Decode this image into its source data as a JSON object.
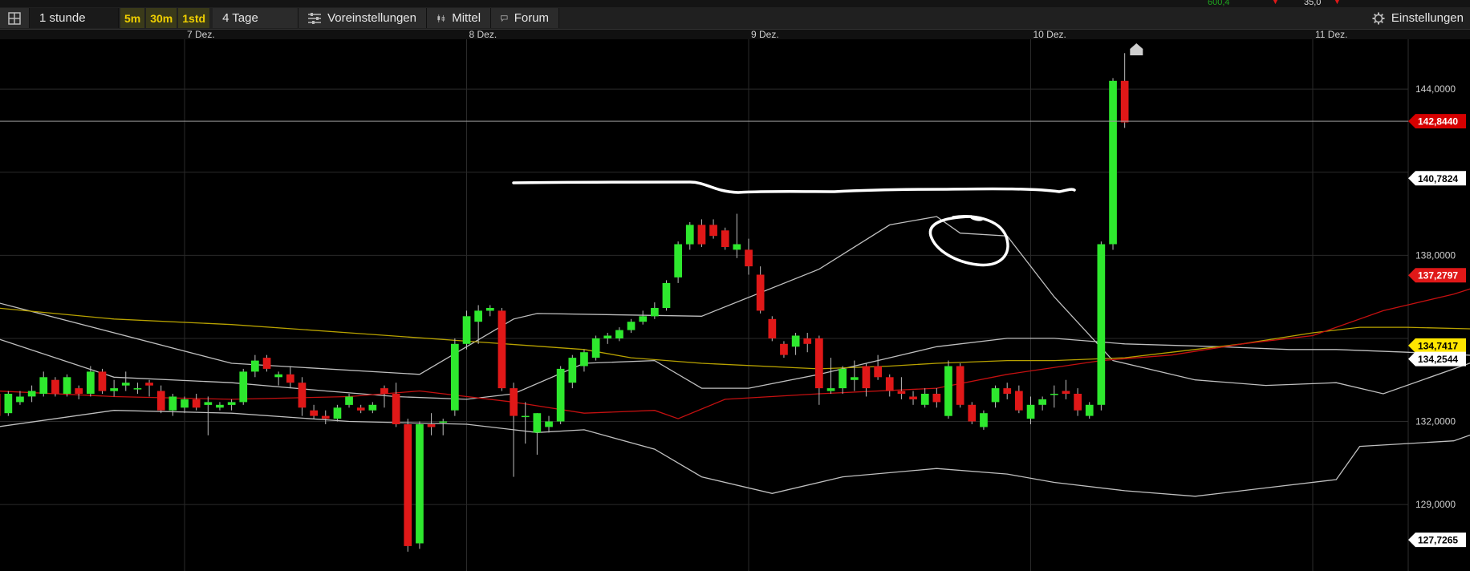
{
  "toolbar": {
    "interval": "1 stunde",
    "timeframes": [
      "5m",
      "30m",
      "1std"
    ],
    "range": "4 Tage",
    "presets": "Voreinstellungen",
    "average": "Mittel",
    "forum": "Forum",
    "settings": "Einstellungen",
    "top_numbers": [
      "600,4",
      "35,0"
    ]
  },
  "chart_data": {
    "type": "candlestick",
    "x_tick_labels": [
      "7 Dez.",
      "8 Dez.",
      "9 Dez.",
      "10 Dez.",
      "11 Dez."
    ],
    "y_tick_labels": [
      "144,0000",
      "138,0000",
      "132,0000",
      "129,0000"
    ],
    "y_ticks": [
      144,
      141,
      138,
      135,
      132,
      129
    ],
    "ylim": [
      126.6,
      145.8
    ],
    "candles_per_day": 24,
    "first_candle_offset": -16,
    "grid": true,
    "candles": [
      [
        133.0,
        133.2,
        132.0,
        132.2
      ],
      [
        132.3,
        133.1,
        132.2,
        133.0
      ],
      [
        132.7,
        133.1,
        132.6,
        132.9
      ],
      [
        132.9,
        133.3,
        132.7,
        133.1
      ],
      [
        133.0,
        133.8,
        132.9,
        133.6
      ],
      [
        133.5,
        133.6,
        132.9,
        133.0
      ],
      [
        133.0,
        133.7,
        132.9,
        133.6
      ],
      [
        133.2,
        133.3,
        132.8,
        133.0
      ],
      [
        133.0,
        134.0,
        132.9,
        133.8
      ],
      [
        133.8,
        133.9,
        133.0,
        133.1
      ],
      [
        133.1,
        133.5,
        132.9,
        133.2
      ],
      [
        133.3,
        133.8,
        133.1,
        133.4
      ],
      [
        133.2,
        133.4,
        133.0,
        133.2
      ],
      [
        133.4,
        133.5,
        132.9,
        133.3
      ],
      [
        133.1,
        133.3,
        132.3,
        132.4
      ],
      [
        132.4,
        133.0,
        132.2,
        132.9
      ],
      [
        132.5,
        132.9,
        132.3,
        132.8
      ],
      [
        132.8,
        133.0,
        132.4,
        132.5
      ],
      [
        132.6,
        132.9,
        131.5,
        132.7
      ],
      [
        132.5,
        132.7,
        132.4,
        132.6
      ],
      [
        132.6,
        132.8,
        132.4,
        132.7
      ],
      [
        132.7,
        133.9,
        132.6,
        133.8
      ],
      [
        133.8,
        134.4,
        133.6,
        134.2
      ],
      [
        134.3,
        134.4,
        133.8,
        133.9
      ],
      [
        133.6,
        133.8,
        133.3,
        133.7
      ],
      [
        133.7,
        134.0,
        133.2,
        133.4
      ],
      [
        133.4,
        133.6,
        132.2,
        132.5
      ],
      [
        132.4,
        132.6,
        132.1,
        132.2
      ],
      [
        132.2,
        132.4,
        131.9,
        132.1
      ],
      [
        132.1,
        132.6,
        132.0,
        132.5
      ],
      [
        132.6,
        133.0,
        132.5,
        132.9
      ],
      [
        132.5,
        132.6,
        132.3,
        132.4
      ],
      [
        132.4,
        132.7,
        132.3,
        132.6
      ],
      [
        133.2,
        133.3,
        132.5,
        133.0
      ],
      [
        133.0,
        133.4,
        131.8,
        131.9
      ],
      [
        131.9,
        132.1,
        127.3,
        127.5
      ],
      [
        127.6,
        132.0,
        127.4,
        131.9
      ],
      [
        131.9,
        132.3,
        131.5,
        131.8
      ],
      [
        132.0,
        132.1,
        131.5,
        132.0
      ],
      [
        132.4,
        135.0,
        132.2,
        134.8
      ],
      [
        134.8,
        136.0,
        134.6,
        135.8
      ],
      [
        135.6,
        136.2,
        134.8,
        136.0
      ],
      [
        136.0,
        136.2,
        135.8,
        136.1
      ],
      [
        136.0,
        136.1,
        133.1,
        133.2
      ],
      [
        133.2,
        133.4,
        130.0,
        132.2
      ],
      [
        132.2,
        132.7,
        131.2,
        132.2
      ],
      [
        131.6,
        132.3,
        130.8,
        132.3
      ],
      [
        131.8,
        132.2,
        131.6,
        132.0
      ],
      [
        132.0,
        134.0,
        131.9,
        133.9
      ],
      [
        133.4,
        134.4,
        133.2,
        134.3
      ],
      [
        134.0,
        134.6,
        133.8,
        134.5
      ],
      [
        134.3,
        135.1,
        134.2,
        135.0
      ],
      [
        135.0,
        135.2,
        134.8,
        135.1
      ],
      [
        135.0,
        135.4,
        134.9,
        135.3
      ],
      [
        135.3,
        135.7,
        135.2,
        135.6
      ],
      [
        135.6,
        136.0,
        135.5,
        135.8
      ],
      [
        135.8,
        136.3,
        135.7,
        136.1
      ],
      [
        136.1,
        137.1,
        136.0,
        137.0
      ],
      [
        137.2,
        138.5,
        137.0,
        138.4
      ],
      [
        138.4,
        139.2,
        138.2,
        139.1
      ],
      [
        139.1,
        139.3,
        138.3,
        138.4
      ],
      [
        139.1,
        139.3,
        138.6,
        138.7
      ],
      [
        138.9,
        139.0,
        138.2,
        138.3
      ],
      [
        138.2,
        139.5,
        137.9,
        138.4
      ],
      [
        138.2,
        138.6,
        137.3,
        137.6
      ],
      [
        137.3,
        137.6,
        135.9,
        136.0
      ],
      [
        135.7,
        135.8,
        134.9,
        135.0
      ],
      [
        134.8,
        134.9,
        134.3,
        134.4
      ],
      [
        134.7,
        135.2,
        134.4,
        135.1
      ],
      [
        135.0,
        135.2,
        134.5,
        134.8
      ],
      [
        135.0,
        135.1,
        132.6,
        133.2
      ],
      [
        133.1,
        134.3,
        133.0,
        133.2
      ],
      [
        133.2,
        134.0,
        133.0,
        133.9
      ],
      [
        133.5,
        134.2,
        133.1,
        133.6
      ],
      [
        134.0,
        134.1,
        132.9,
        133.2
      ],
      [
        134.0,
        134.4,
        133.5,
        133.6
      ],
      [
        133.6,
        133.7,
        132.9,
        133.1
      ],
      [
        133.1,
        133.6,
        132.8,
        133.0
      ],
      [
        132.9,
        133.1,
        132.6,
        132.8
      ],
      [
        132.6,
        133.2,
        132.5,
        133.0
      ],
      [
        133.0,
        133.2,
        132.5,
        132.7
      ],
      [
        132.2,
        134.2,
        132.1,
        134.0
      ],
      [
        134.0,
        134.1,
        132.5,
        132.6
      ],
      [
        132.6,
        132.7,
        131.9,
        132.0
      ],
      [
        131.8,
        132.4,
        131.7,
        132.3
      ],
      [
        132.7,
        133.3,
        132.5,
        133.2
      ],
      [
        133.2,
        133.4,
        132.8,
        133.0
      ],
      [
        133.1,
        133.3,
        132.3,
        132.4
      ],
      [
        132.1,
        132.9,
        131.9,
        132.6
      ],
      [
        132.6,
        132.9,
        132.4,
        132.8
      ],
      [
        133.0,
        133.3,
        132.5,
        133.0
      ],
      [
        133.1,
        133.5,
        132.8,
        133.0
      ],
      [
        133.0,
        133.2,
        132.2,
        132.4
      ],
      [
        132.2,
        132.7,
        132.1,
        132.6
      ],
      [
        132.6,
        138.5,
        132.4,
        138.4
      ],
      [
        138.4,
        144.4,
        138.2,
        144.3
      ],
      [
        144.3,
        145.3,
        142.6,
        142.8
      ]
    ],
    "bollinger_upper": [
      [
        0,
        136.3
      ],
      [
        20,
        134.1
      ],
      [
        36,
        133.7
      ],
      [
        44,
        135.7
      ],
      [
        46,
        135.9
      ],
      [
        60,
        135.8
      ],
      [
        70,
        137.5
      ],
      [
        76,
        139.1
      ],
      [
        80,
        139.4
      ],
      [
        82,
        138.8
      ],
      [
        86,
        138.7
      ],
      [
        90,
        136.5
      ],
      [
        95,
        134.2
      ],
      [
        102,
        133.5
      ],
      [
        108,
        133.3
      ],
      [
        114,
        133.4
      ],
      [
        118,
        133.0
      ],
      [
        126,
        134.2
      ],
      [
        137,
        134.3
      ],
      [
        146,
        137.3
      ],
      [
        154,
        138.9
      ],
      [
        164,
        140.1
      ],
      [
        168,
        138.9
      ],
      [
        169,
        140.4
      ]
    ],
    "bollinger_middle": [
      [
        0,
        135.0
      ],
      [
        10,
        133.6
      ],
      [
        20,
        133.4
      ],
      [
        28,
        133.1
      ],
      [
        34,
        132.9
      ],
      [
        40,
        132.8
      ],
      [
        44,
        133.0
      ],
      [
        50,
        134.1
      ],
      [
        56,
        134.2
      ],
      [
        60,
        133.2
      ],
      [
        64,
        133.2
      ],
      [
        70,
        133.7
      ],
      [
        76,
        134.3
      ],
      [
        80,
        134.7
      ],
      [
        86,
        135.0
      ],
      [
        90,
        135.0
      ],
      [
        96,
        134.8
      ],
      [
        104,
        134.7
      ],
      [
        110,
        134.6
      ],
      [
        114,
        134.6
      ],
      [
        120,
        134.5
      ],
      [
        130,
        134.3
      ],
      [
        134,
        134.3
      ],
      [
        138,
        134.6
      ],
      [
        146,
        135.4
      ],
      [
        150,
        135.5
      ],
      [
        154,
        135.4
      ],
      [
        160,
        134.7
      ],
      [
        164,
        134.3
      ],
      [
        168,
        133.3
      ],
      [
        170,
        133.7
      ],
      [
        172,
        134.4
      ]
    ],
    "bollinger_lower": [
      [
        0,
        131.8
      ],
      [
        10,
        132.4
      ],
      [
        20,
        132.3
      ],
      [
        30,
        132.0
      ],
      [
        40,
        131.9
      ],
      [
        46,
        131.6
      ],
      [
        50,
        131.7
      ],
      [
        56,
        131.0
      ],
      [
        60,
        130.0
      ],
      [
        66,
        129.4
      ],
      [
        72,
        130.0
      ],
      [
        80,
        130.3
      ],
      [
        86,
        130.1
      ],
      [
        90,
        129.8
      ],
      [
        96,
        129.5
      ],
      [
        102,
        129.3
      ],
      [
        108,
        129.6
      ],
      [
        114,
        129.9
      ],
      [
        116,
        131.1
      ],
      [
        124,
        131.3
      ],
      [
        128,
        131.9
      ],
      [
        134,
        132.4
      ],
      [
        138,
        132.6
      ],
      [
        144,
        132.4
      ],
      [
        150,
        131.6
      ],
      [
        156,
        130.8
      ],
      [
        164,
        131.4
      ],
      [
        168,
        131.6
      ],
      [
        170,
        131.4
      ],
      [
        172,
        129.5
      ],
      [
        174,
        128.6
      ],
      [
        176,
        128.0
      ]
    ],
    "sma_yellow": [
      [
        0,
        136.1
      ],
      [
        10,
        135.7
      ],
      [
        20,
        135.5
      ],
      [
        30,
        135.2
      ],
      [
        40,
        134.9
      ],
      [
        50,
        134.6
      ],
      [
        54,
        134.3
      ],
      [
        60,
        134.1
      ],
      [
        70,
        133.9
      ],
      [
        76,
        134.0
      ],
      [
        80,
        134.1
      ],
      [
        86,
        134.2
      ],
      [
        90,
        134.2
      ],
      [
        96,
        134.3
      ],
      [
        100,
        134.5
      ],
      [
        106,
        134.8
      ],
      [
        112,
        135.2
      ],
      [
        116,
        135.4
      ],
      [
        120,
        135.4
      ],
      [
        130,
        135.3
      ],
      [
        134,
        135.3
      ],
      [
        138,
        135.2
      ],
      [
        144,
        134.9
      ],
      [
        150,
        134.6
      ],
      [
        156,
        134.3
      ],
      [
        162,
        134.4
      ],
      [
        166,
        134.5
      ],
      [
        168,
        134.5
      ],
      [
        170,
        134.6
      ],
      [
        174,
        135.0
      ],
      [
        176,
        135.3
      ]
    ],
    "ema_red": [
      [
        0,
        133.1
      ],
      [
        10,
        132.9
      ],
      [
        20,
        132.8
      ],
      [
        30,
        132.9
      ],
      [
        36,
        133.1
      ],
      [
        44,
        132.7
      ],
      [
        50,
        132.3
      ],
      [
        56,
        132.4
      ],
      [
        58,
        132.1
      ],
      [
        62,
        132.8
      ],
      [
        70,
        133.0
      ],
      [
        80,
        133.2
      ],
      [
        86,
        133.7
      ],
      [
        94,
        134.2
      ],
      [
        100,
        134.4
      ],
      [
        106,
        134.8
      ],
      [
        112,
        135.1
      ],
      [
        118,
        136.0
      ],
      [
        124,
        136.6
      ],
      [
        130,
        137.4
      ],
      [
        134,
        137.2
      ],
      [
        138,
        136.8
      ],
      [
        144,
        135.7
      ],
      [
        150,
        135.0
      ],
      [
        156,
        134.5
      ],
      [
        162,
        134.1
      ],
      [
        168,
        133.5
      ],
      [
        172,
        132.9
      ],
      [
        178,
        133.0
      ],
      [
        182,
        133.1
      ],
      [
        186,
        133.2
      ],
      [
        190,
        132.9
      ],
      [
        194,
        133.2
      ],
      [
        196,
        133.5
      ],
      [
        200,
        134.4
      ],
      [
        204,
        137.0
      ]
    ],
    "horizontal_line": 142.844,
    "price_tags": [
      {
        "label": "142,8440",
        "value": 142.844,
        "bg": "#d60000",
        "fg": "#ffffff"
      },
      {
        "label": "140,7824",
        "value": 140.7824,
        "bg": "#ffffff",
        "fg": "#000000"
      },
      {
        "label": "137,2797",
        "value": 137.2797,
        "bg": "#e01818",
        "fg": "#ffffff"
      },
      {
        "label": "134,7417",
        "value": 134.7417,
        "bg": "#ffe600",
        "fg": "#000000"
      },
      {
        "label": "134,2544",
        "value": 134.2544,
        "bg": "#ffffff",
        "fg": "#000000"
      },
      {
        "label": "127,7265",
        "value": 127.7265,
        "bg": "#ffffff",
        "fg": "#000000"
      }
    ],
    "colors": {
      "up": "#2ee82e",
      "down": "#e01818",
      "grid": "#2a2a2a",
      "band": "#bfbfbf",
      "sma": "#b8a200",
      "ema": "#c41010"
    }
  }
}
